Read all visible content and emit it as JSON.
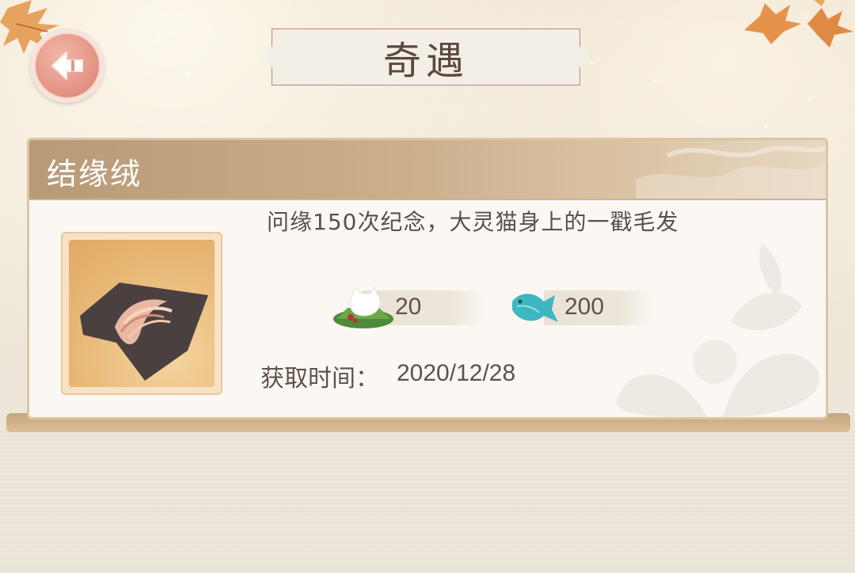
{
  "header": {
    "title": "奇遇",
    "back_icon": "back-arrow-icon"
  },
  "card": {
    "name": "结缘绒",
    "description": "问缘150次纪念，大灵猫身上的一戳毛发",
    "item_icon": "fur-tuft-icon",
    "costs": [
      {
        "icon": "rice-dumpling-icon",
        "value": "20"
      },
      {
        "icon": "fish-icon",
        "value": "200"
      }
    ],
    "obtained_label": "获取时间：",
    "obtained_date": "2020/12/28"
  },
  "colors": {
    "header_band": "#b89a78",
    "back_button": "#e59686",
    "fish": "#3fb6c0"
  }
}
